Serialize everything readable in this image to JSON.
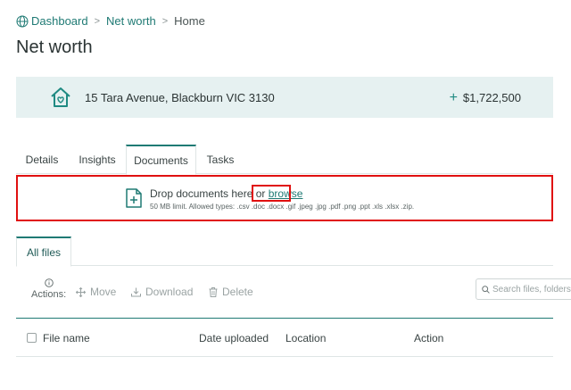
{
  "breadcrumb": {
    "items": [
      "Dashboard",
      "Net worth"
    ],
    "separator": ">",
    "current": "Home"
  },
  "page_title": "Net worth",
  "property": {
    "address": "15 Tara Avenue, Blackburn VIC 3130",
    "value": "$1,722,500",
    "icon": "house-heart-icon"
  },
  "tabs": [
    {
      "label": "Details",
      "active": false
    },
    {
      "label": "Insights",
      "active": false
    },
    {
      "label": "Documents",
      "active": true
    },
    {
      "label": "Tasks",
      "active": false
    }
  ],
  "dropzone": {
    "text": "Drop documents here or",
    "browse_label": "browse",
    "limits": "50 MB limit. Allowed types: .csv .doc .docx .gif .jpeg .jpg .pdf .png .ppt .xls .xlsx .zip."
  },
  "files_tab": "All files",
  "actions": {
    "label": "Actions:",
    "move": "Move",
    "download": "Download",
    "delete": "Delete"
  },
  "search": {
    "placeholder": "Search files, folders"
  },
  "table": {
    "columns": [
      "File name",
      "Date uploaded",
      "Location",
      "Action"
    ]
  },
  "colors": {
    "accent": "#1f7a74",
    "card_bg": "#e6f1f1",
    "highlight": "#e01010"
  }
}
